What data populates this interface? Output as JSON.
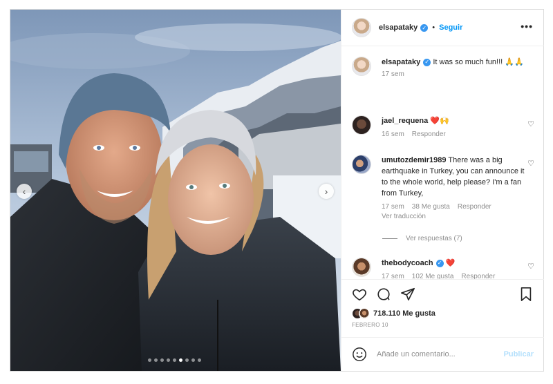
{
  "post": {
    "username": "elsapataky",
    "follow_label": "Seguir",
    "more_icon": "more-horizontal-icon"
  },
  "comments": [
    {
      "username": "elsapataky",
      "text": "It was so much fun!!! 🙏🙏",
      "time": "17 sem",
      "verified": true
    },
    {
      "username": "jael_requena",
      "text": "❤️🙌",
      "time": "16 sem",
      "reply_label": "Responder"
    },
    {
      "username": "umutozdemir1989",
      "text": "There was a big earthquake in Turkey, you can announce it to the whole world, help please? I'm a fan from Turkey,",
      "time": "17 sem",
      "likes": "38 Me gusta",
      "reply_label": "Responder",
      "translate_label": "Ver traducción"
    },
    {
      "username": "thebodycoach",
      "text": "❤️",
      "time": "17 sem",
      "likes": "102 Me gusta",
      "reply_label": "Responder",
      "verified": true
    }
  ],
  "view_replies": "Ver respuestas (7)",
  "likes_count": "718.110 Me gusta",
  "date": "FEBRERO 10",
  "add_comment": {
    "placeholder": "Añade un comentario...",
    "publish_label": "Publicar"
  },
  "carousel": {
    "dots": 9,
    "active_dot": 5
  },
  "colors": {
    "accent": "#0095f6",
    "verified": "#3897f0",
    "heart": "#ed4956",
    "muted": "#8e8e8e"
  }
}
